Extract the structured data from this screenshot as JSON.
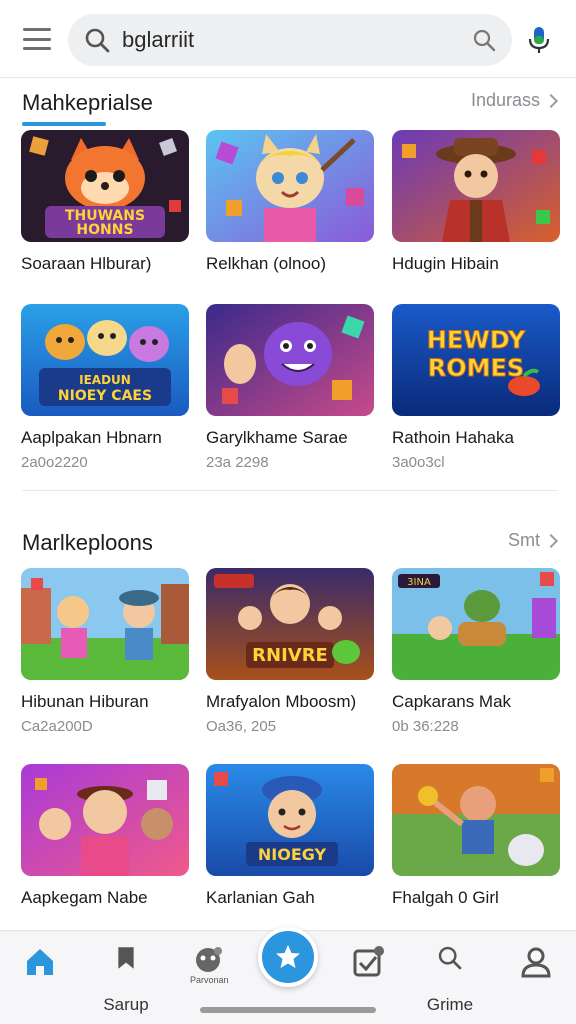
{
  "search": {
    "value": "bglarriit"
  },
  "section1": {
    "title": "Mahkeprialse",
    "more_label": "Indurass",
    "cards": [
      {
        "name": "Soaraan Hlburar)",
        "meta": "",
        "art_text_1": "THUWANS",
        "art_text_2": "HONNS"
      },
      {
        "name": "Relkhan (olnoo)",
        "meta": ""
      },
      {
        "name": "Hdugin Hibain",
        "meta": ""
      },
      {
        "name": "Aaplpakan Hbnarn",
        "meta": "2a0o2220",
        "art_text_1": "IEADUN",
        "art_text_2": "NIOEY CAES"
      },
      {
        "name": "Garylkhame Sarae",
        "meta": "23a 2298"
      },
      {
        "name": "Rathoin Hahaka",
        "meta": "3a0o3cl",
        "art_text_1": "HEWDY",
        "art_text_2": "ROMES"
      }
    ]
  },
  "section2": {
    "title": "Marlkeploons",
    "more_label": "Smt",
    "cards": [
      {
        "name": "Hibunan Hiburan",
        "meta": "Ca2a200D"
      },
      {
        "name": "Mrafyalon Mboosm)",
        "meta": "Oa36, 205",
        "art_text_1": "RNIVRE"
      },
      {
        "name": "Capkarans Mak",
        "meta": "0b 36:228",
        "art_text_1": "3INA"
      },
      {
        "name": "Aapkegam Nabe",
        "meta": ""
      },
      {
        "name": "Karlanian Gah",
        "meta": "",
        "art_text_1": "NIOEGY"
      },
      {
        "name": "Fhalgah 0 Girl",
        "meta": ""
      }
    ]
  },
  "bottom_nav": {
    "items": [
      {
        "label": "",
        "icon": "home-icon"
      },
      {
        "label": "Sarup",
        "icon": "bookmark-icon"
      },
      {
        "label": "",
        "icon": "games-icon",
        "sub_label": "Parvonan"
      },
      {
        "label": "",
        "icon": "star-icon"
      },
      {
        "label": "",
        "icon": "tasks-icon"
      },
      {
        "label": "Grime",
        "icon": "search-icon"
      },
      {
        "label": "",
        "icon": "profile-icon"
      }
    ]
  },
  "colors": {
    "accent": "#2b95dd",
    "text_primary": "#1d1d1f",
    "text_secondary": "#8b8b8b",
    "background": "#ffffff",
    "search_bg": "#eeeff1"
  }
}
